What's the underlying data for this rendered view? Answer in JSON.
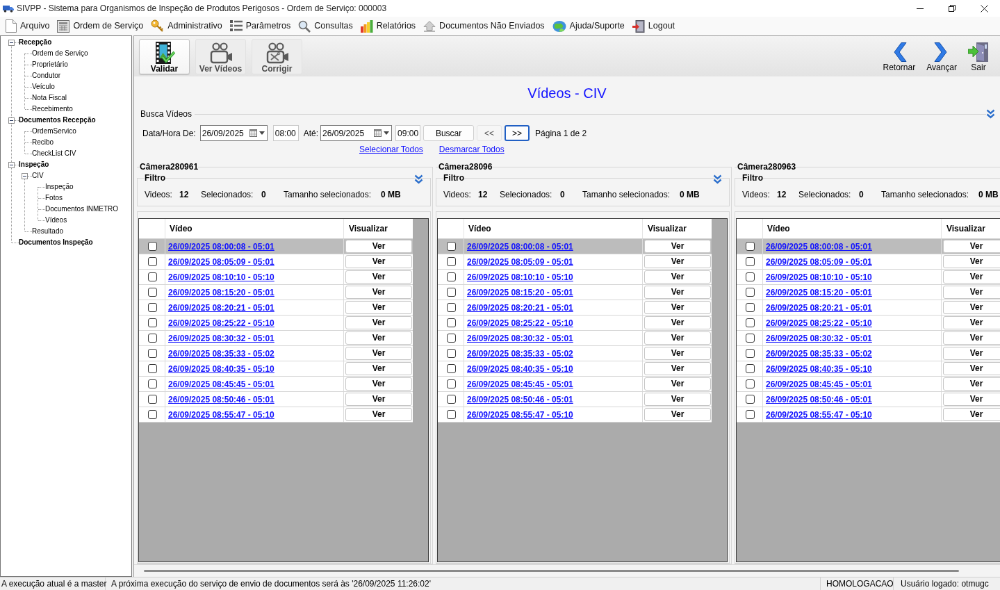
{
  "window": {
    "title": "SIVPP - Sistema para Organismos de Inspeção de Produtos Perigosos - Ordem de Serviço: 000003"
  },
  "menu": [
    {
      "label": "Arquivo"
    },
    {
      "label": "Ordem de Serviço"
    },
    {
      "label": "Administrativo"
    },
    {
      "label": "Parâmetros"
    },
    {
      "label": "Consultas"
    },
    {
      "label": "Relatórios"
    },
    {
      "label": "Documentos Não Enviados"
    },
    {
      "label": "Ajuda/Suporte"
    },
    {
      "label": "Logout"
    }
  ],
  "tree": [
    {
      "label": "Recepção",
      "expanded": true,
      "children": [
        {
          "label": "Ordem de Serviço"
        },
        {
          "label": "Proprietário"
        },
        {
          "label": "Condutor"
        },
        {
          "label": "Veículo"
        },
        {
          "label": "Nota Fiscal"
        },
        {
          "label": "Recebimento"
        }
      ]
    },
    {
      "label": "Documentos Recepção",
      "expanded": true,
      "children": [
        {
          "label": "OrdemServico"
        },
        {
          "label": "Recibo"
        },
        {
          "label": "CheckList CIV"
        }
      ]
    },
    {
      "label": "Inspeção",
      "expanded": true,
      "children": [
        {
          "label": "CIV",
          "expanded": true,
          "children": [
            {
              "label": "Inspeção"
            },
            {
              "label": "Fotos"
            },
            {
              "label": "Documentos INMETRO"
            },
            {
              "label": "Vídeos"
            }
          ]
        },
        {
          "label": "Resultado"
        }
      ]
    },
    {
      "label": "Documentos Inspeção"
    }
  ],
  "toolbar": {
    "actions": [
      {
        "label": "Validar",
        "selected": true
      },
      {
        "label": "Ver Vídeos",
        "selected": false
      },
      {
        "label": "Corrigir",
        "selected": false
      }
    ],
    "navigation": [
      {
        "label": "Retornar"
      },
      {
        "label": "Avançar"
      },
      {
        "label": "Sair"
      }
    ]
  },
  "page_title": "Vídeos - CIV",
  "search": {
    "group_label": "Busca Vídeos",
    "from_label": "Data/Hora De:",
    "from_date": "26/09/2025",
    "from_time": "08:00",
    "to_label": "Até:",
    "to_date": "26/09/2025",
    "to_time": "09:00",
    "search_button": "Buscar",
    "pager": [
      {
        "label": "<<",
        "disabled": true,
        "focused": false
      },
      {
        "label": ">>",
        "disabled": false,
        "focused": true
      }
    ],
    "page_info": "Página 1 de 2",
    "select_all_link": "Selecionar Todos",
    "deselect_all_link": "Desmarcar Todos"
  },
  "cameras": [
    {
      "name": "Câmera280961",
      "filter": {
        "legend": "Filtro",
        "stats": [
          {
            "label": "Videos:",
            "value": "12"
          },
          {
            "label": "Selecionados:",
            "value": "0"
          },
          {
            "label": "Tamanho selecionados:",
            "value": "0 MB"
          }
        ]
      },
      "columns": [
        "Vídeo",
        "Visualizar"
      ],
      "rows": [
        {
          "video": "26/09/2025 08:00:08 - 05:01",
          "checked": false,
          "selected": true,
          "view_button": "Ver"
        },
        {
          "video": "26/09/2025 08:05:09 - 05:01",
          "checked": false,
          "selected": false,
          "view_button": "Ver"
        },
        {
          "video": "26/09/2025 08:10:10 - 05:10",
          "checked": false,
          "selected": false,
          "view_button": "Ver"
        },
        {
          "video": "26/09/2025 08:15:20 - 05:01",
          "checked": false,
          "selected": false,
          "view_button": "Ver"
        },
        {
          "video": "26/09/2025 08:20:21 - 05:01",
          "checked": false,
          "selected": false,
          "view_button": "Ver"
        },
        {
          "video": "26/09/2025 08:25:22 - 05:10",
          "checked": false,
          "selected": false,
          "view_button": "Ver"
        },
        {
          "video": "26/09/2025 08:30:32 - 05:01",
          "checked": false,
          "selected": false,
          "view_button": "Ver"
        },
        {
          "video": "26/09/2025 08:35:33 - 05:02",
          "checked": false,
          "selected": false,
          "view_button": "Ver"
        },
        {
          "video": "26/09/2025 08:40:35 - 05:10",
          "checked": false,
          "selected": false,
          "view_button": "Ver"
        },
        {
          "video": "26/09/2025 08:45:45 - 05:01",
          "checked": false,
          "selected": false,
          "view_button": "Ver"
        },
        {
          "video": "26/09/2025 08:50:46 - 05:01",
          "checked": false,
          "selected": false,
          "view_button": "Ver"
        },
        {
          "video": "26/09/2025 08:55:47 - 05:10",
          "checked": false,
          "selected": false,
          "view_button": "Ver"
        }
      ]
    },
    {
      "name": "Câmera28096",
      "filter": {
        "legend": "Filtro",
        "stats": [
          {
            "label": "Videos:",
            "value": "12"
          },
          {
            "label": "Selecionados:",
            "value": "0"
          },
          {
            "label": "Tamanho selecionados:",
            "value": "0 MB"
          }
        ]
      },
      "columns": [
        "Vídeo",
        "Visualizar"
      ],
      "rows": [
        {
          "video": "26/09/2025 08:00:08 - 05:01",
          "checked": false,
          "selected": true,
          "view_button": "Ver"
        },
        {
          "video": "26/09/2025 08:05:09 - 05:01",
          "checked": false,
          "selected": false,
          "view_button": "Ver"
        },
        {
          "video": "26/09/2025 08:10:10 - 05:10",
          "checked": false,
          "selected": false,
          "view_button": "Ver"
        },
        {
          "video": "26/09/2025 08:15:20 - 05:01",
          "checked": false,
          "selected": false,
          "view_button": "Ver"
        },
        {
          "video": "26/09/2025 08:20:21 - 05:01",
          "checked": false,
          "selected": false,
          "view_button": "Ver"
        },
        {
          "video": "26/09/2025 08:25:22 - 05:10",
          "checked": false,
          "selected": false,
          "view_button": "Ver"
        },
        {
          "video": "26/09/2025 08:30:32 - 05:01",
          "checked": false,
          "selected": false,
          "view_button": "Ver"
        },
        {
          "video": "26/09/2025 08:35:33 - 05:02",
          "checked": false,
          "selected": false,
          "view_button": "Ver"
        },
        {
          "video": "26/09/2025 08:40:35 - 05:10",
          "checked": false,
          "selected": false,
          "view_button": "Ver"
        },
        {
          "video": "26/09/2025 08:45:45 - 05:01",
          "checked": false,
          "selected": false,
          "view_button": "Ver"
        },
        {
          "video": "26/09/2025 08:50:46 - 05:01",
          "checked": false,
          "selected": false,
          "view_button": "Ver"
        },
        {
          "video": "26/09/2025 08:55:47 - 05:10",
          "checked": false,
          "selected": false,
          "view_button": "Ver"
        }
      ]
    },
    {
      "name": "Câmera280963",
      "filter": {
        "legend": "Filtro",
        "stats": [
          {
            "label": "Videos:",
            "value": "12"
          },
          {
            "label": "Selecionados:",
            "value": "0"
          },
          {
            "label": "Tamanho selecionados:",
            "value": "0 MB"
          }
        ]
      },
      "columns": [
        "Vídeo",
        "Visualizar"
      ],
      "rows": [
        {
          "video": "26/09/2025 08:00:08 - 05:01",
          "checked": false,
          "selected": true,
          "view_button": "Ver"
        },
        {
          "video": "26/09/2025 08:05:09 - 05:01",
          "checked": false,
          "selected": false,
          "view_button": "Ver"
        },
        {
          "video": "26/09/2025 08:10:10 - 05:10",
          "checked": false,
          "selected": false,
          "view_button": "Ver"
        },
        {
          "video": "26/09/2025 08:15:20 - 05:01",
          "checked": false,
          "selected": false,
          "view_button": "Ver"
        },
        {
          "video": "26/09/2025 08:20:21 - 05:01",
          "checked": false,
          "selected": false,
          "view_button": "Ver"
        },
        {
          "video": "26/09/2025 08:25:22 - 05:10",
          "checked": false,
          "selected": false,
          "view_button": "Ver"
        },
        {
          "video": "26/09/2025 08:30:32 - 05:01",
          "checked": false,
          "selected": false,
          "view_button": "Ver"
        },
        {
          "video": "26/09/2025 08:35:33 - 05:02",
          "checked": false,
          "selected": false,
          "view_button": "Ver"
        },
        {
          "video": "26/09/2025 08:40:35 - 05:10",
          "checked": false,
          "selected": false,
          "view_button": "Ver"
        },
        {
          "video": "26/09/2025 08:45:45 - 05:01",
          "checked": false,
          "selected": false,
          "view_button": "Ver"
        },
        {
          "video": "26/09/2025 08:50:46 - 05:01",
          "checked": false,
          "selected": false,
          "view_button": "Ver"
        },
        {
          "video": "26/09/2025 08:55:47 - 05:10",
          "checked": false,
          "selected": false,
          "view_button": "Ver"
        }
      ]
    }
  ],
  "status_bar": [
    "A execução atual é a master",
    "A próxima execução do serviço de envio de documentos será às '26/09/2025 11:26:02'",
    "HOMOLOGACAO",
    "Usuário logado: otmugc"
  ]
}
